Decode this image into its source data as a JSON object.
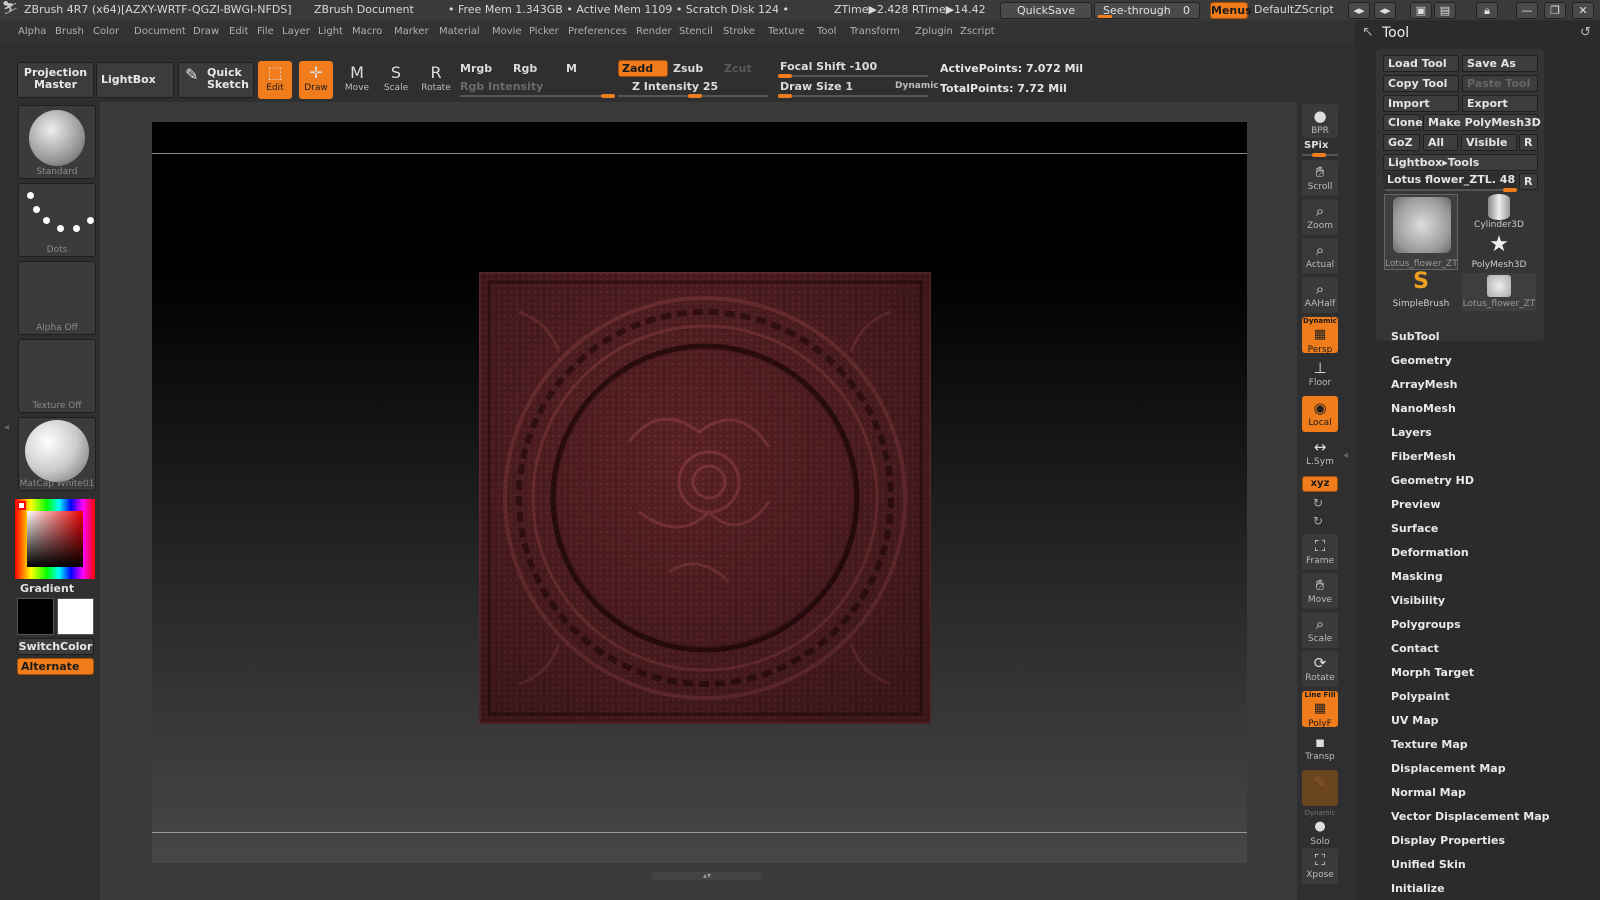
{
  "titlebar": {
    "app": "ZBrush 4R7 (x64)[AZXY-WRTF-QGZI-BWGI-NFDS]",
    "document": "ZBrush Document",
    "stats": "• Free Mem 1.343GB • Active Mem 1109 • Scratch Disk 124 •",
    "ztime": "ZTime▶2.428 RTime▶14.42",
    "quicksave": "QuickSave",
    "seethrough": "See-through",
    "seethrough_value": "0",
    "menus": "Menus",
    "script": "DefaultZScript"
  },
  "menu": [
    "Alpha",
    "Brush",
    "Color",
    "Document",
    "Draw",
    "Edit",
    "File",
    "Layer",
    "Light",
    "Macro",
    "Marker",
    "Material",
    "Movie",
    "Picker",
    "Preferences",
    "Render",
    "Stencil",
    "Stroke",
    "Texture",
    "Tool",
    "Transform",
    "Zplugin",
    "Zscript"
  ],
  "shelf": {
    "projection_master": "Projection Master",
    "lightbox": "LightBox",
    "quick_sketch": "Quick Sketch",
    "edit": "Edit",
    "draw": "Draw",
    "move": "Move",
    "scale": "Scale",
    "rotate": "Rotate",
    "mrgb": "Mrgb",
    "rgb": "Rgb",
    "m": "M",
    "rgb_intensity": "Rgb Intensity",
    "zadd": "Zadd",
    "zsub": "Zsub",
    "zcut": "Zcut",
    "z_intensity": "Z Intensity 25",
    "focal_shift": "Focal Shift -100",
    "draw_size": "Draw Size 1",
    "dynamic": "Dynamic",
    "active_points": "ActivePoints: 7.072 Mil",
    "total_points": "TotalPoints: 7.72 Mil"
  },
  "left": {
    "brush": "Standard",
    "stroke": "Dots",
    "alpha": "Alpha Off",
    "texture": "Texture Off",
    "material": "MatCap White01",
    "gradient": "Gradient",
    "switchcolor": "SwitchColor",
    "alternate": "Alternate"
  },
  "right": {
    "bpr": "BPR",
    "spix": "SPix",
    "items": [
      "Scroll",
      "Zoom",
      "Actual",
      "AAHalf",
      "Persp",
      "Floor",
      "Local",
      "L.Sym",
      "Frame",
      "Move",
      "Scale",
      "Rotate",
      "PolyF",
      "Transp",
      "Solo",
      "Xpose"
    ],
    "xyz": "xyz",
    "dynamic_persp": "Dynamic",
    "linefill": "Line Fill",
    "dynamic_solo": "Dynamic"
  },
  "palette": {
    "title": "Tool",
    "load_tool": "Load Tool",
    "save_as": "Save As",
    "copy_tool": "Copy Tool",
    "paste_tool": "Paste Tool",
    "import": "Import",
    "export": "Export",
    "clone": "Clone",
    "make_polymesh": "Make PolyMesh3D",
    "goz": "GoZ",
    "all": "All",
    "visible": "Visible",
    "r": "R",
    "lightbox_tools": "Lightbox▸Tools",
    "current_tool": "Lotus flower_ZTL. 48",
    "thumbs": [
      "Lotus_flower_ZT",
      "Cylinder3D",
      "PolyMesh3D",
      "SimpleBrush",
      "Lotus_flower_ZT"
    ],
    "sections": [
      "SubTool",
      "Geometry",
      "ArrayMesh",
      "NanoMesh",
      "Layers",
      "FiberMesh",
      "Geometry HD",
      "Preview",
      "Surface",
      "Deformation",
      "Masking",
      "Visibility",
      "Polygroups",
      "Contact",
      "Morph Target",
      "Polypaint",
      "UV Map",
      "Texture Map",
      "Displacement Map",
      "Normal Map",
      "Vector Displacement Map",
      "Display Properties",
      "Unified Skin",
      "Initialize"
    ]
  },
  "colors": {
    "accent": "#f07c1b",
    "model": "#5a2226",
    "bg": "#2e2e2e"
  }
}
